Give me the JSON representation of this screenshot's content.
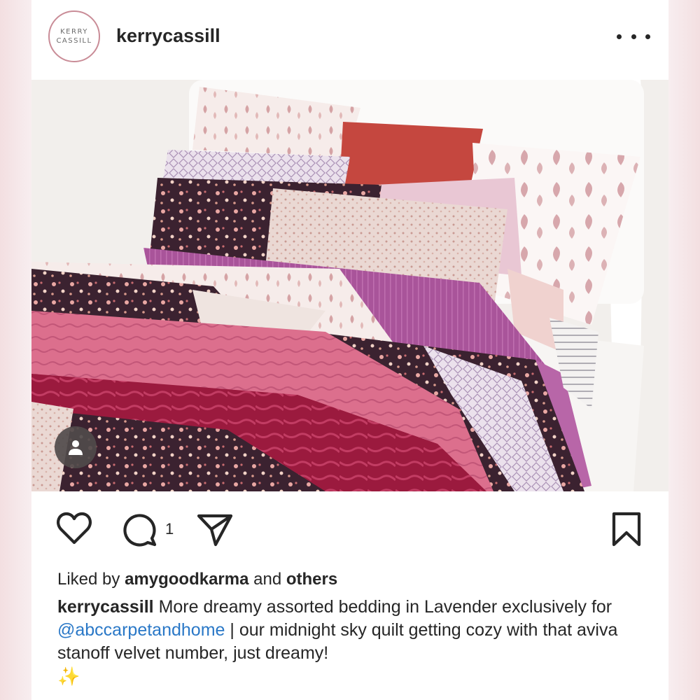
{
  "post": {
    "username": "kerrycassill",
    "avatar": {
      "line1": "KERRY",
      "line2": "CASSILL"
    },
    "icons": {
      "more": "more-options-icon",
      "tag": "tagged-user-icon",
      "like": "heart-icon",
      "comment": "comment-bubble-icon",
      "share": "send-icon",
      "save": "bookmark-icon"
    },
    "comment_count": "1",
    "likes": {
      "prefix": "Liked by",
      "user": "amygoodkarma",
      "connector": "and",
      "others": "others"
    },
    "caption": {
      "author": "kerrycassill",
      "text_before": "More dreamy assorted bedding in Lavender exclusively for",
      "mention": "@abccarpetandhome",
      "text_after": "| our midnight sky quilt getting cozy with that aviva stanoff velvet number, just dreamy!",
      "emoji": "✨"
    },
    "colors": {
      "text": "#262626",
      "mention": "#2a78c7",
      "avatar_ring": "#c98c97"
    }
  }
}
